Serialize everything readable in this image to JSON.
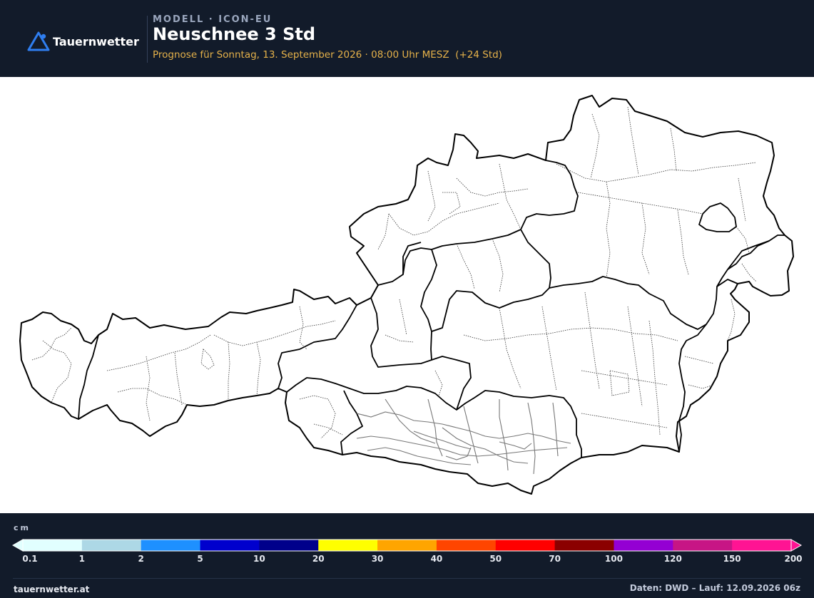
{
  "header": {
    "brand": "Tauernwetter",
    "model": "MODELL · ICON-EU",
    "title": "Neuschnee 3 Std",
    "subtitle": "Prognose für Sonntag, 13. September 2026 · 08:00 Uhr MESZ  (+24 Std)"
  },
  "colors": {
    "header_bg": "#121b2a",
    "subtitle": "#e6b24a",
    "logo_accent": "#2f7ef0"
  },
  "icons": {
    "logo": "mountain-triangle-icon"
  },
  "legend": {
    "unit": "cm",
    "bins": [
      {
        "color": "#e1ffff"
      },
      {
        "color": "#add8e6"
      },
      {
        "color": "#1e90ff"
      },
      {
        "color": "#0000cd"
      },
      {
        "color": "#00008b"
      },
      {
        "color": "#ffff00"
      },
      {
        "color": "#ffa500"
      },
      {
        "color": "#ff4500"
      },
      {
        "color": "#ff0000"
      },
      {
        "color": "#8b0000"
      },
      {
        "color": "#9400d3"
      },
      {
        "color": "#c71585"
      },
      {
        "color": "#ff1493"
      }
    ],
    "ticks": [
      "0.1",
      "1",
      "2",
      "5",
      "10",
      "20",
      "30",
      "40",
      "50",
      "70",
      "100",
      "120",
      "150",
      "200"
    ]
  },
  "footer": {
    "site": "tauernwetter.at",
    "source": "Daten: DWD – Lauf: 12.09.2026 06z"
  }
}
